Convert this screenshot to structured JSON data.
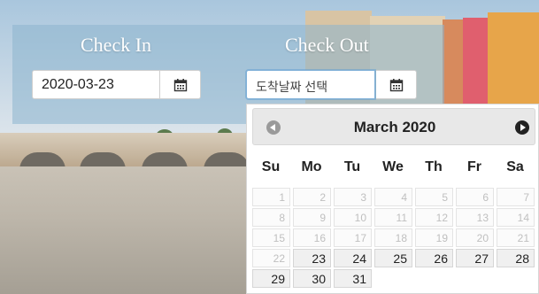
{
  "form": {
    "check_in_label": "Check In",
    "check_out_label": "Check Out",
    "check_in_value": "2020-03-23",
    "check_out_placeholder": "도착날짜 선택"
  },
  "datepicker": {
    "month_title": "March 2020",
    "weekdays": [
      "Su",
      "Mo",
      "Tu",
      "We",
      "Th",
      "Fr",
      "Sa"
    ],
    "weeks": [
      [
        {
          "day": "1",
          "state": "disabled"
        },
        {
          "day": "2",
          "state": "disabled"
        },
        {
          "day": "3",
          "state": "disabled"
        },
        {
          "day": "4",
          "state": "disabled"
        },
        {
          "day": "5",
          "state": "disabled"
        },
        {
          "day": "6",
          "state": "disabled"
        },
        {
          "day": "7",
          "state": "disabled"
        }
      ],
      [
        {
          "day": "8",
          "state": "disabled"
        },
        {
          "day": "9",
          "state": "disabled"
        },
        {
          "day": "10",
          "state": "disabled"
        },
        {
          "day": "11",
          "state": "disabled"
        },
        {
          "day": "12",
          "state": "disabled"
        },
        {
          "day": "13",
          "state": "disabled"
        },
        {
          "day": "14",
          "state": "disabled"
        }
      ],
      [
        {
          "day": "15",
          "state": "disabled"
        },
        {
          "day": "16",
          "state": "disabled"
        },
        {
          "day": "17",
          "state": "disabled"
        },
        {
          "day": "18",
          "state": "disabled"
        },
        {
          "day": "19",
          "state": "disabled"
        },
        {
          "day": "20",
          "state": "disabled"
        },
        {
          "day": "21",
          "state": "disabled"
        }
      ],
      [
        {
          "day": "22",
          "state": "disabled"
        },
        {
          "day": "23",
          "state": "enabled"
        },
        {
          "day": "24",
          "state": "enabled"
        },
        {
          "day": "25",
          "state": "enabled"
        },
        {
          "day": "26",
          "state": "enabled"
        },
        {
          "day": "27",
          "state": "enabled"
        },
        {
          "day": "28",
          "state": "enabled"
        }
      ],
      [
        {
          "day": "29",
          "state": "enabled"
        },
        {
          "day": "30",
          "state": "enabled"
        },
        {
          "day": "31",
          "state": "enabled"
        }
      ]
    ]
  },
  "icons": {
    "calendar": "calendar-icon",
    "prev": "prev-month-icon",
    "next": "next-month-icon"
  },
  "colors": {
    "header_bg": "#e8e8e8",
    "disabled_text": "#bfbfbf",
    "enabled_bg": "#f0f0f0"
  }
}
